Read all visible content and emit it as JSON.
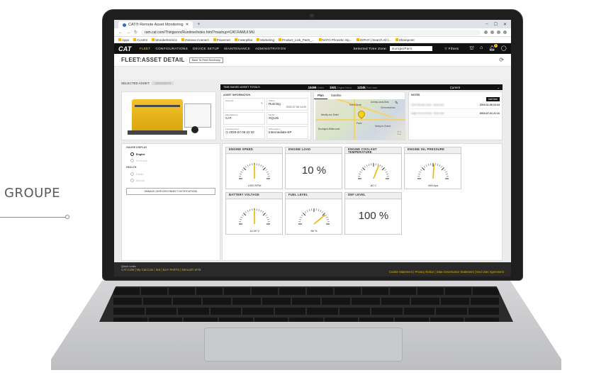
{
  "brand_label": "GROUPE",
  "browser": {
    "tab_title": "CAT® Remote Asset Monitoring",
    "new_tab": "+",
    "url": "ram.cat.com/Thingworx/Runtime/index.html?mashup=CAT.RAMUI.MU",
    "bookmarks": [
      "Apps",
      "CLUES",
      "Wonderference",
      "Geneva Connect",
      "Powernet",
      "Caterpillar",
      "Marketing",
      "Product_Link_Parts_...",
      "NATO Phonetic Alp...",
      "GIPHY | Search All t...",
      "Sharepoint"
    ],
    "win_controls": [
      "–",
      "☐",
      "✕"
    ]
  },
  "appnav": {
    "logo": "CAT",
    "items": [
      "FLEET",
      "CONFIGURATIONS",
      "DEVICE SETUP",
      "MAINTENANCE",
      "ADMINISTRATION"
    ],
    "tz_label": "Selected Time Zone:",
    "tz_value": "Europe/Paris",
    "filters": "Filters",
    "bell_count": "1"
  },
  "page": {
    "title": "FLEET:ASSET DETAIL",
    "back_button": "Back To Fleet Summary",
    "selected_asset_label": "SELECTED ASSET:",
    "selected_asset_value": "GEN000578"
  },
  "totals": {
    "label": "TIME BASED ASSET TOTALS",
    "n1": "10499",
    "n1_sub": "Online",
    "n2": "1931",
    "n2_sub": "Engine Hours",
    "n3": "1224k",
    "n3_sub": "Fuel Used",
    "period": "Current"
  },
  "asset_info": {
    "title": "ASSET INFORMATION",
    "asset_id_label": "Asset ID",
    "status_label": "Status",
    "status_value": "Running",
    "status_time": "2020-07-06 14:03",
    "manufacturer_label": "Manufacturer",
    "manufacturer_value": "CAT",
    "model_label": "Model",
    "model_value": "XQ125",
    "last_reported_label": "Last Reported",
    "last_reported_value": "2020-07-06 22:32",
    "subscription_label": "Subscription",
    "subscription_value": "Intermediate-EP"
  },
  "map": {
    "tab_plan": "Plan",
    "tab_satellite": "Satellite",
    "labels": [
      "Saint-Denis",
      "Aulnay-sous-Bois",
      "Neuilly-sur-Seine",
      "Paris",
      "Boulogne-Billancourt",
      "Noisy-le-Grand",
      "Chennevières"
    ]
  },
  "notes": {
    "title": "NOTES",
    "add_button": "Add Note",
    "rows": [
      {
        "text": "Clint Woods (Jan) - Nota test",
        "date": "2019-11-08 16:34"
      },
      {
        "text": "Sage Kovac (Feb) - Nota test",
        "date": "2019-07-31 21:11"
      }
    ]
  },
  "left_panel": {
    "gauge_display": "GAUGE DISPLAY",
    "engine": "Engine",
    "electrical": "Electrical",
    "health": "HEALTH",
    "faults": "Faults",
    "alarms": "Alarms",
    "manage_btn": "MANAGE 24HR DISCONNECT NOTIFICATIONS"
  },
  "gauges": [
    {
      "title": "ENGINE SPEED",
      "type": "dial",
      "value_text": "1000 RPM",
      "fraction": 0.5
    },
    {
      "title": "ENGINE LOAD",
      "type": "number",
      "value_text": "10 %"
    },
    {
      "title": "ENGINE COOLANT TEMPERATURE",
      "type": "dial",
      "value_text": "82 C",
      "fraction": 0.62
    },
    {
      "title": "ENGINE OIL PRESSURE",
      "type": "dial",
      "value_text": "456 kpa",
      "fraction": 0.52
    },
    {
      "title": "BATTERY VOLTAGE",
      "type": "dial",
      "value_text": "14.00 V",
      "fraction": 0.5
    },
    {
      "title": "FUEL LEVEL",
      "type": "dial",
      "value_text": "88 %",
      "fraction": 0.78
    },
    {
      "title": "DEF LEVEL",
      "type": "number",
      "value_text": "100 %"
    }
  ],
  "footer": {
    "quick_links": "Quick Links",
    "links_left": "CAT.COM | My Cat.Com | SIS | BUY PARTS | DEALER SITE",
    "links_right": "Cookie Statement | Privacy Notice | Data Governance Statement | End User Agreement"
  },
  "colors": {
    "cat_yellow": "#ffcd11",
    "nav_black": "#111111",
    "needle": "#f2b600"
  }
}
